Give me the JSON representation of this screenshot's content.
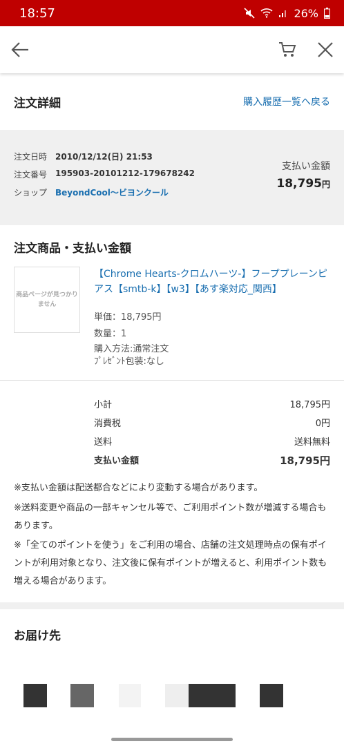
{
  "status": {
    "time": "18:57",
    "battery": "26%"
  },
  "header": {
    "title": "注文詳細",
    "history_link": "購入履歴一覧へ戻る"
  },
  "order": {
    "date_label": "注文日時",
    "date_value": "2010/12/12(日) 21:53",
    "number_label": "注文番号",
    "number_value": "195903-20101212-179678242",
    "shop_label": "ショップ",
    "shop_value": "BeyondCool〜ビヨンクール",
    "pay_label": "支払い金額",
    "pay_value": "18,795",
    "pay_unit": "円"
  },
  "products": {
    "title": "注文商品・支払い金額",
    "image_placeholder": "商品ページが見つかりません",
    "name": "【Chrome Hearts-クロムハーツ-】フーププレーンピアス【smtb-k】【w3】【あす楽対応_関西】",
    "unit_price": "単価：18,795円",
    "quantity": "数量：1",
    "purchase_method": "購入方法:通常注文",
    "gift_wrap": "ﾌﾟﾚｾﾞﾝﾄ包装:なし"
  },
  "summary": {
    "subtotal_label": "小計",
    "subtotal_value": "18,795円",
    "tax_label": "消費税",
    "tax_value": "0円",
    "shipping_label": "送料",
    "shipping_value": "送料無料",
    "total_label": "支払い金額",
    "total_value": "18,795円"
  },
  "notes": [
    "※支払い金額は配送都合などにより変動する場合があります。",
    "※送料変更や商品の一部キャンセル等で、ご利用ポイント数が増減する場合もあります。",
    "※「全てのポイントを使う」をご利用の場合、店舗の注文処理時点の保有ポイントが利用対象となり、注文後に保有ポイントが増えると、利用ポイント数も増える場合があります。"
  ],
  "delivery": {
    "title": "お届け先"
  },
  "colors": {
    "accent_red": "#bf0000",
    "link_blue": "#1a6fb0"
  }
}
